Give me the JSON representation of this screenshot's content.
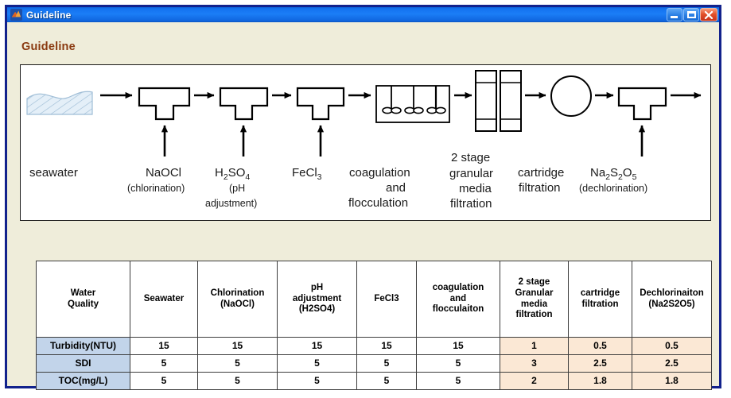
{
  "window": {
    "title": "Guideline",
    "icon": "matlab-membrane-icon",
    "buttons": {
      "minimize": "Minimize",
      "maximize": "Maximize",
      "close": "Close"
    }
  },
  "section": {
    "title": "Guideline"
  },
  "diagram": {
    "name": "seawater-pretreatment-process-flow",
    "stages": [
      {
        "id": "seawater",
        "shape": "wave-hatched-body",
        "label": "seawater",
        "sub": ""
      },
      {
        "id": "naocl",
        "shape": "tee-dosing-unit",
        "label": "NaOCl",
        "sub": "(chlorination)"
      },
      {
        "id": "h2so4",
        "shape": "tee-dosing-unit",
        "label": "H2SO4",
        "sub": "(pH adjustment)"
      },
      {
        "id": "fecl3",
        "shape": "tee-dosing-unit",
        "label": "FeCl3",
        "sub": ""
      },
      {
        "id": "coagulation",
        "shape": "mixer-tank",
        "label": "coagulation and flocculation",
        "sub": ""
      },
      {
        "id": "granular",
        "shape": "dual-column-filter",
        "label": "2 stage granular media filtration",
        "sub": ""
      },
      {
        "id": "cartridge",
        "shape": "circle-filter",
        "label": "cartridge filtration",
        "sub": ""
      },
      {
        "id": "na2s2o5",
        "shape": "tee-dosing-unit",
        "label": "Na2S2O5",
        "sub": "(dechlorination)"
      }
    ],
    "labels": {
      "seawater": "seawater",
      "naocl": "NaOCl",
      "naocl_sub": "(chlorination)",
      "h2so4_a": "H",
      "h2so4_b": "2",
      "h2so4_c": "SO",
      "h2so4_d": "4",
      "h2so4_sub1": "(pH",
      "h2so4_sub2": "adjustment)",
      "fecl3_a": "FeCl",
      "fecl3_b": "3",
      "coag1": "coagulation",
      "coag2": "and",
      "coag3": "flocculation",
      "gran1": "2 stage",
      "gran2": "granular",
      "gran3": "media",
      "gran4": "filtration",
      "cart1": "cartridge",
      "cart2": "filtration",
      "na_a": "Na",
      "na_b": "2",
      "na_c": "S",
      "na_d": "2",
      "na_e": "O",
      "na_f": "5",
      "na_sub": "(dechlorination)"
    }
  },
  "table": {
    "name": "water-quality-guideline-table",
    "headers": [
      "Water Quality",
      "Seawater",
      "Chlorination (NaOCl)",
      "pH adjustment (H2SO4)",
      "FeCl3",
      "coagulation and flocculaiton",
      "2 stage Granular media filtration",
      "cartridge filtration",
      "Dechlorinaiton (Na2S2O5)"
    ],
    "header_lines": [
      [
        "Water",
        "Quality"
      ],
      [
        "Seawater"
      ],
      [
        "Chlorination",
        "(NaOCl)"
      ],
      [
        "pH",
        "adjustment",
        "(H2SO4)"
      ],
      [
        "FeCl3"
      ],
      [
        "coagulation",
        "and",
        "flocculaiton"
      ],
      [
        "2 stage",
        "Granular",
        "media",
        "filtration"
      ],
      [
        "cartridge",
        "filtration"
      ],
      [
        "Dechlorinaiton",
        "(Na2S2O5)"
      ]
    ],
    "rows": [
      {
        "label": "Turbidity(NTU)",
        "values": [
          "15",
          "15",
          "15",
          "15",
          "15",
          "1",
          "0.5",
          "0.5"
        ]
      },
      {
        "label": "SDI",
        "values": [
          "5",
          "5",
          "5",
          "5",
          "5",
          "3",
          "2.5",
          "2.5"
        ]
      },
      {
        "label": "TOC(mg/L)",
        "values": [
          "5",
          "5",
          "5",
          "5",
          "5",
          "2",
          "1.8",
          "1.8"
        ]
      }
    ],
    "highlight_from_column": 5,
    "colors": {
      "row_label_bg": "#c2d4ea",
      "highlight_bg": "#fbe8d5",
      "border": "#3d3d3d"
    }
  },
  "colors": {
    "titlebar_blue": "#1b7ef7",
    "window_border": "#12228c",
    "client_bg": "#efedda",
    "section_title": "#8a3a10",
    "panel_bg": "#ffffff",
    "seawater_fill": "#dce9f5"
  }
}
